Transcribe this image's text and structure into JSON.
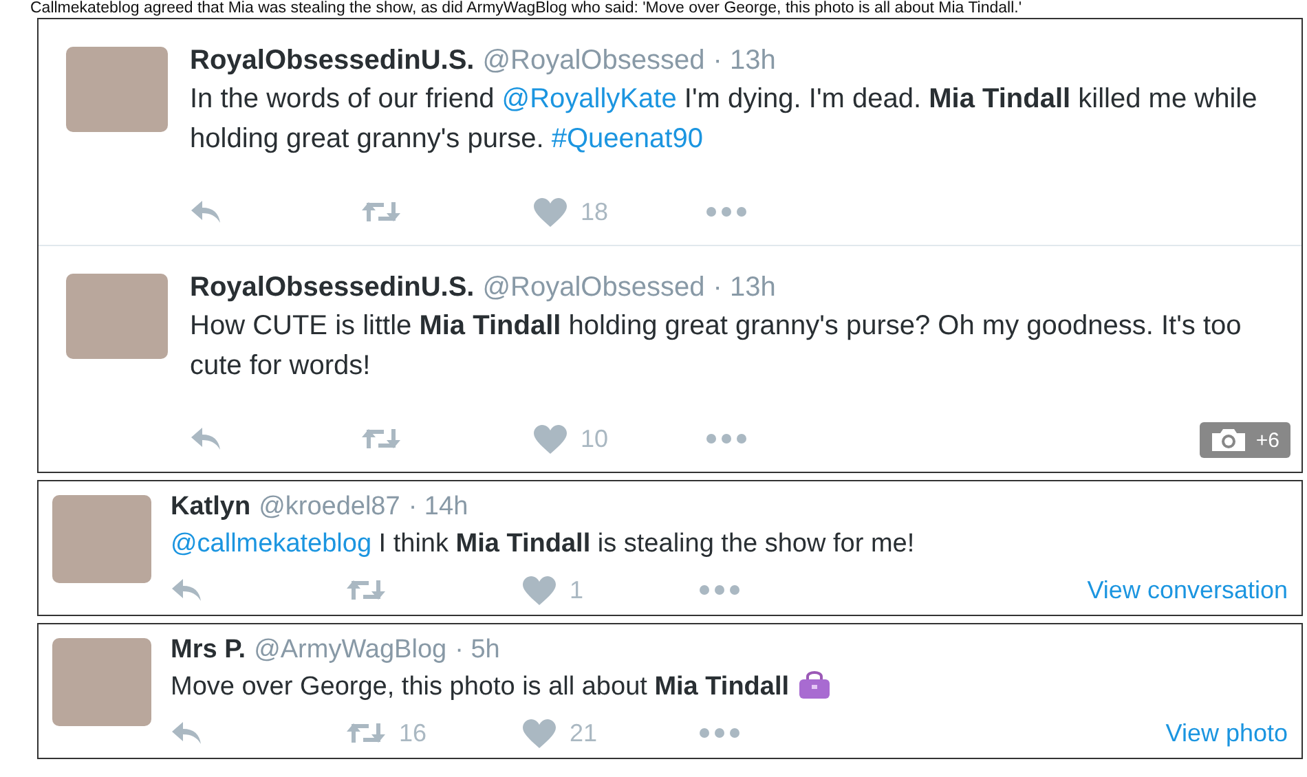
{
  "caption": "Callmekateblog agreed that Mia was stealing the show, as did ArmyWagBlog who said: 'Move over George, this photo is all about Mia Tindall.'",
  "cards": [
    {
      "kind": "large",
      "tweets": [
        {
          "name": "RoyalObsessedinU.S.",
          "handle": "@RoyalObsessed",
          "time": "· 13h",
          "text": [
            {
              "kind": "plain",
              "text": "In the words of our friend "
            },
            {
              "kind": "link",
              "text": "@RoyallyKate"
            },
            {
              "kind": "plain",
              "text": " I'm dying. I'm dead. "
            },
            {
              "kind": "bold",
              "text": "Mia Tindall"
            },
            {
              "kind": "plain",
              "text": " killed me while holding great granny's purse. "
            },
            {
              "kind": "link",
              "text": "#Queenat90"
            }
          ],
          "likes": "18"
        },
        {
          "name": "RoyalObsessedinU.S.",
          "handle": "@RoyalObsessed",
          "time": "· 13h",
          "text": [
            {
              "kind": "plain",
              "text": "How CUTE is little "
            },
            {
              "kind": "bold",
              "text": "Mia Tindall"
            },
            {
              "kind": "plain",
              "text": " holding great granny's purse? Oh my goodness. It's too cute for words!"
            }
          ],
          "likes": "10",
          "photo_badge": "+6"
        }
      ]
    },
    {
      "kind": "small",
      "tweets": [
        {
          "name": "Katlyn",
          "handle": "@kroedel87",
          "time": "· 14h",
          "text": [
            {
              "kind": "link",
              "text": "@callmekateblog"
            },
            {
              "kind": "plain",
              "text": " I think "
            },
            {
              "kind": "bold",
              "text": "Mia Tindall"
            },
            {
              "kind": "plain",
              "text": " is stealing the show for me!"
            }
          ],
          "likes": "1",
          "footer_link": "View conversation"
        }
      ]
    },
    {
      "kind": "small",
      "tweets": [
        {
          "name": "Mrs P.",
          "handle": "@ArmyWagBlog",
          "time": "· 5h",
          "text": [
            {
              "kind": "plain",
              "text": "Move over George, this photo is all about "
            },
            {
              "kind": "bold",
              "text": "Mia Tindall"
            }
          ],
          "has_emoji": true,
          "retweets": "16",
          "likes": "21",
          "footer_link": "View photo"
        }
      ]
    }
  ]
}
